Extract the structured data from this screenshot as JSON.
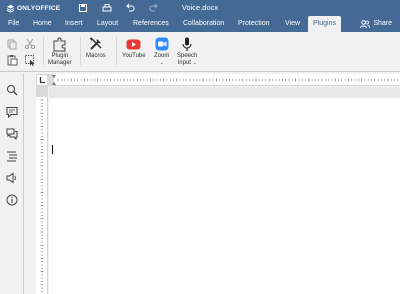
{
  "app": {
    "brand": "ONLYOFFICE",
    "doc_title": "Voice.docx",
    "accent": "#446995"
  },
  "menu": {
    "tabs": [
      {
        "label": "File"
      },
      {
        "label": "Home"
      },
      {
        "label": "Insert"
      },
      {
        "label": "Layout"
      },
      {
        "label": "References"
      },
      {
        "label": "Collaboration"
      },
      {
        "label": "Protection"
      },
      {
        "label": "View"
      },
      {
        "label": "Plugins",
        "active": true
      }
    ],
    "share_label": "Share"
  },
  "toolbar": {
    "plugin_manager": {
      "line1": "Plugin",
      "line2": "Manager",
      "icon": "puzzle-icon"
    },
    "macros": {
      "label": "Macros",
      "icon": "tools-icon"
    },
    "youtube": {
      "label": "YouTube",
      "icon": "youtube-icon"
    },
    "zoom": {
      "label": "Zoom",
      "icon": "zoom-camera-icon"
    },
    "speech": {
      "line1": "Speech",
      "line2": "Input",
      "icon": "microphone-icon"
    }
  },
  "left_panel": {
    "icons": [
      "search-icon",
      "comment-icon",
      "chat-icon",
      "navigation-icon",
      "speaker-icon",
      "info-icon"
    ]
  }
}
